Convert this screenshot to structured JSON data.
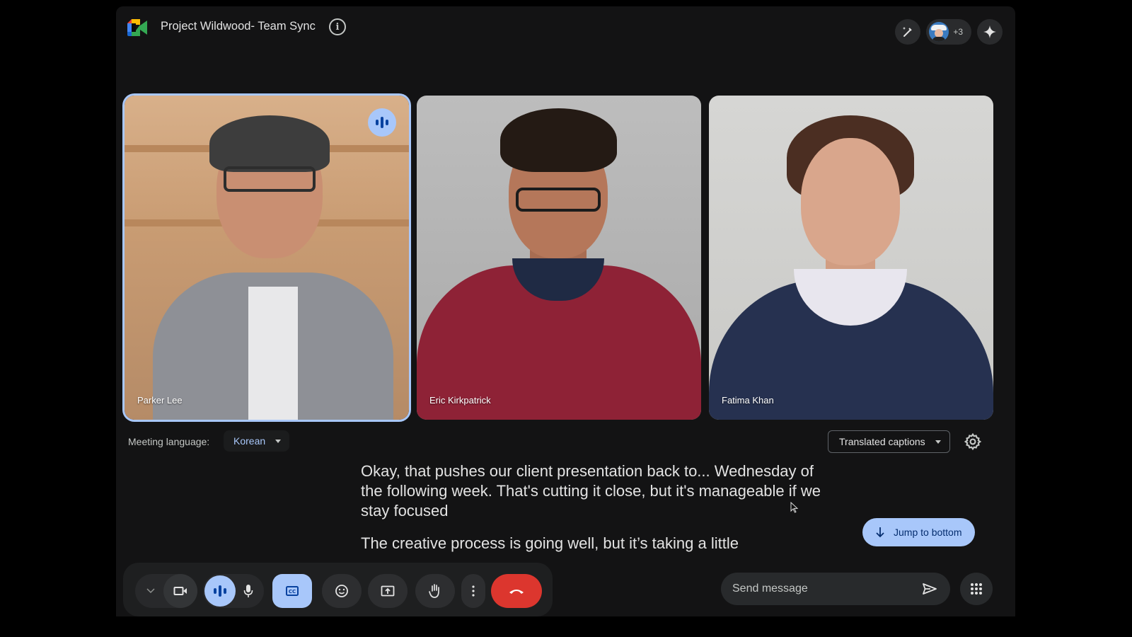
{
  "header": {
    "title": "Project Wildwood- Team Sync",
    "info_icon": "info-icon",
    "more_participants": "+3",
    "icons": [
      "pen-sparkle-icon",
      "participant-avatar",
      "gemini-sparkle-icon"
    ]
  },
  "participants": [
    {
      "name": "Parker Lee",
      "speaking": true
    },
    {
      "name": "Eric Kirkpatrick",
      "speaking": false
    },
    {
      "name": "Fatima Khan",
      "speaking": false
    }
  ],
  "captions": {
    "meeting_language_label": "Meeting language:",
    "meeting_language": "Korean",
    "caption_mode": "Translated captions",
    "lines": [
      "Okay, that pushes our client presentation back to... Wednesday of the following week. That's cutting it close, but it's manageable if we stay focused",
      "The creative process is going well, but it’s taking a little"
    ],
    "jump_to_bottom": "Jump to bottom"
  },
  "controls": {
    "buttons": [
      "more-options-chevron",
      "camera",
      "speaking-indicator",
      "microphone",
      "captions",
      "emoji-reactions",
      "present-screen",
      "raise-hand",
      "more-actions",
      "leave-call"
    ],
    "captions_active": true
  },
  "chat": {
    "placeholder": "Send message",
    "send_icon": "send-icon"
  },
  "colors": {
    "accent": "#a8c7fa",
    "accent_text": "#062e6f",
    "end_call": "#dc362e",
    "background": "#131314"
  }
}
